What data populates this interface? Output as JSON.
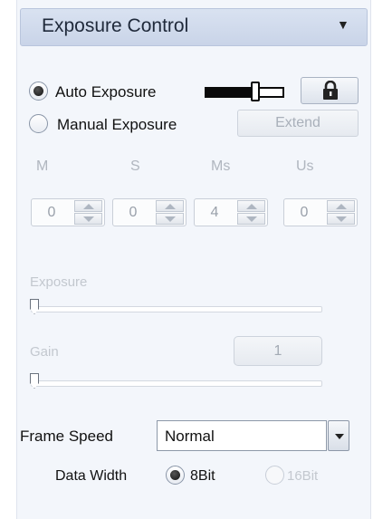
{
  "header": {
    "title": "Exposure Control",
    "collapse_icon": "▼"
  },
  "auto_exposure": {
    "label": "Auto Exposure",
    "checked": true,
    "lock_icon": "lock-icon"
  },
  "manual_exposure": {
    "label": "Manual Exposure",
    "checked": false,
    "extend_label": "Extend"
  },
  "time_fields": [
    {
      "label": "M",
      "value": "0"
    },
    {
      "label": "S",
      "value": "0"
    },
    {
      "label": "Ms",
      "value": "4"
    },
    {
      "label": "Us",
      "value": "0"
    }
  ],
  "exposure_slider": {
    "label": "Exposure"
  },
  "gain": {
    "label": "Gain",
    "value": "1"
  },
  "frame_speed": {
    "label": "Frame Speed",
    "value": "Normal"
  },
  "data_width": {
    "label": "Data Width",
    "options": [
      "8Bit",
      "16Bit"
    ],
    "selected": "8Bit"
  }
}
